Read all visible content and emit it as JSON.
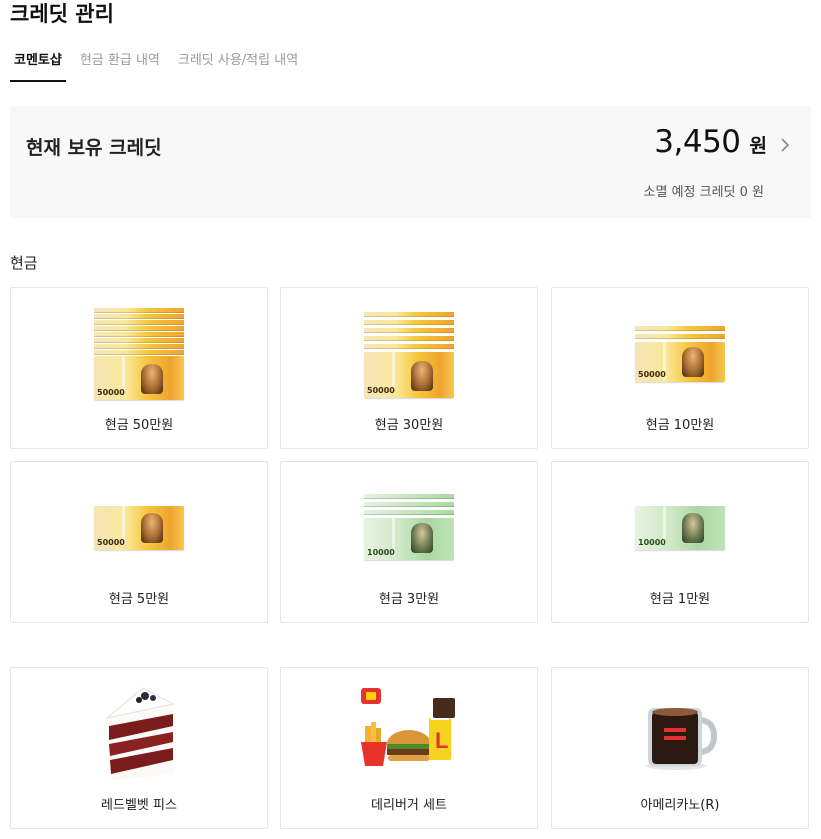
{
  "page": {
    "title": "크레딧 관리"
  },
  "tabs": [
    {
      "label": "코멘토샵",
      "active": true
    },
    {
      "label": "현금 환급 내역",
      "active": false
    },
    {
      "label": "크레딧 사용/적립 내역",
      "active": false
    }
  ],
  "credit": {
    "label": "현재 보유 크레딧",
    "amount": "3,450",
    "unit": "원",
    "expire_label": "소멸 예정 크레딧 0 원"
  },
  "cash_section": {
    "title": "현금",
    "items": [
      {
        "name": "현금 50만원",
        "note_color": "yellow",
        "note_denom": "50000"
      },
      {
        "name": "현금 30만원",
        "note_color": "yellow",
        "note_denom": "50000"
      },
      {
        "name": "현금 10만원",
        "note_color": "yellow",
        "note_denom": "50000"
      },
      {
        "name": "현금 5만원",
        "note_color": "yellow",
        "note_denom": "50000"
      },
      {
        "name": "현금 3만원",
        "note_color": "green",
        "note_denom": "10000"
      },
      {
        "name": "현금 1만원",
        "note_color": "green",
        "note_denom": "10000"
      }
    ]
  },
  "products": {
    "items": [
      {
        "name": "레드벨벳 피스",
        "icon": "cake-slice-icon"
      },
      {
        "name": "데리버거 세트",
        "icon": "burger-set-icon"
      },
      {
        "name": "아메리카노(R)",
        "icon": "coffee-mug-icon"
      }
    ]
  },
  "colors": {
    "tab_active": "#111111",
    "tab_inactive": "#9a9a9a",
    "credit_box_bg": "#f8f8f8",
    "card_border": "#e6e6e6"
  }
}
